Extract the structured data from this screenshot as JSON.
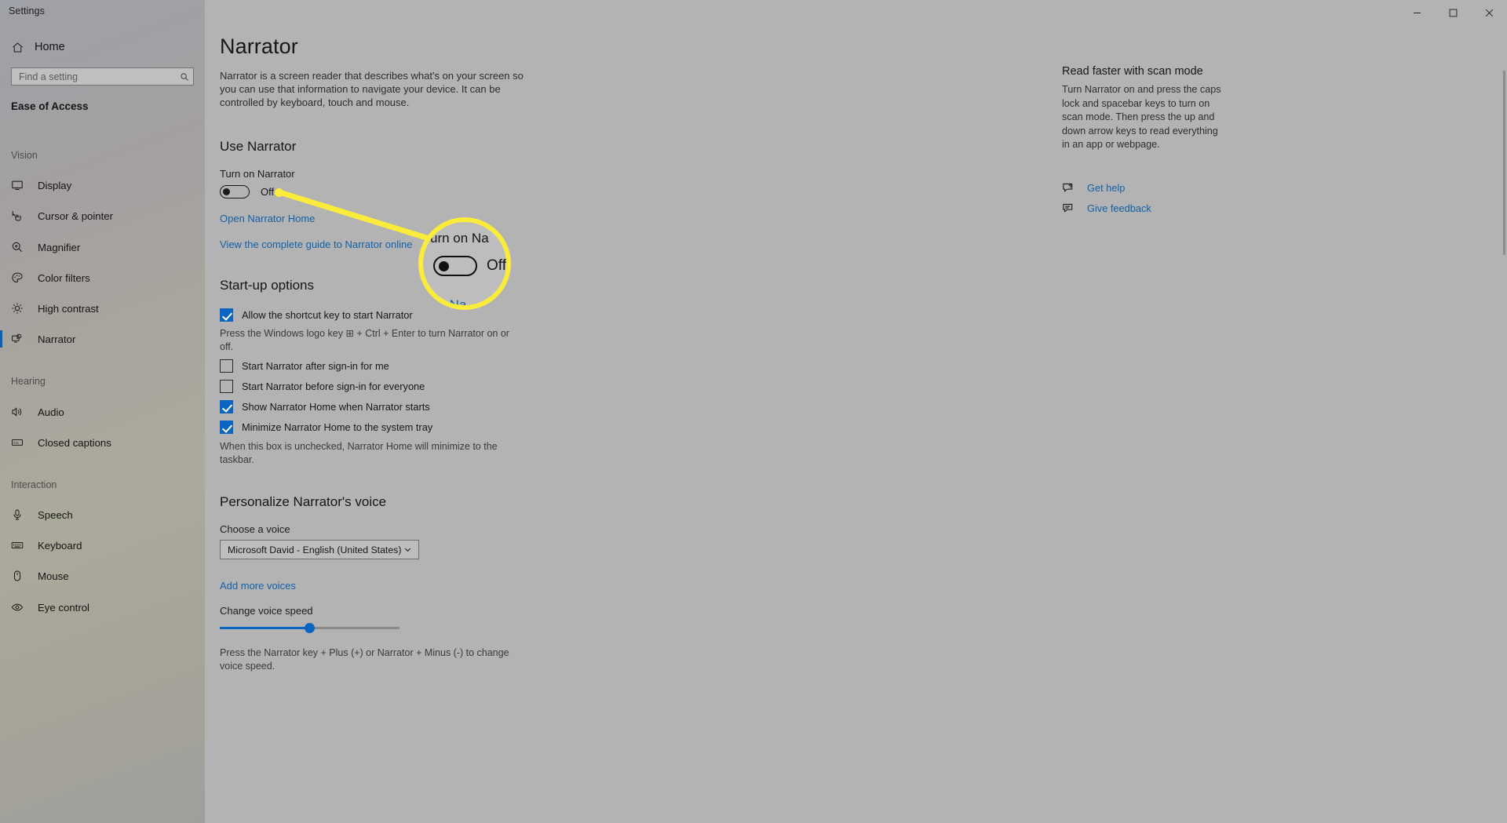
{
  "window": {
    "app_title": "Settings",
    "minimize_label": "Minimize",
    "maximize_label": "Maximize",
    "close_label": "Close"
  },
  "sidebar": {
    "home_label": "Home",
    "search": {
      "placeholder": "Find a setting",
      "value": ""
    },
    "section_title": "Ease of Access",
    "groups": [
      {
        "label": "Vision",
        "items": [
          {
            "label": "Display",
            "icon": "monitor-icon",
            "active": false
          },
          {
            "label": "Cursor & pointer",
            "icon": "cursor-pointer-icon",
            "active": false
          },
          {
            "label": "Magnifier",
            "icon": "magnifier-icon",
            "active": false
          },
          {
            "label": "Color filters",
            "icon": "palette-icon",
            "active": false
          },
          {
            "label": "High contrast",
            "icon": "brightness-icon",
            "active": false
          },
          {
            "label": "Narrator",
            "icon": "narrator-icon",
            "active": true
          }
        ]
      },
      {
        "label": "Hearing",
        "items": [
          {
            "label": "Audio",
            "icon": "speaker-icon",
            "active": false
          },
          {
            "label": "Closed captions",
            "icon": "closed-captions-icon",
            "active": false
          }
        ]
      },
      {
        "label": "Interaction",
        "items": [
          {
            "label": "Speech",
            "icon": "microphone-icon",
            "active": false
          },
          {
            "label": "Keyboard",
            "icon": "keyboard-icon",
            "active": false
          },
          {
            "label": "Mouse",
            "icon": "mouse-icon",
            "active": false
          },
          {
            "label": "Eye control",
            "icon": "eye-icon",
            "active": false
          }
        ]
      }
    ]
  },
  "main": {
    "title": "Narrator",
    "description": "Narrator is a screen reader that describes what's on your screen so you can use that information to navigate your device. It can be controlled by keyboard, touch and mouse.",
    "use_narrator": {
      "heading": "Use Narrator",
      "toggle_label": "Turn on Narrator",
      "toggle_state": "Off",
      "toggle_on": false,
      "open_home_link": "Open Narrator Home",
      "guide_link": "View the complete guide to Narrator online"
    },
    "startup": {
      "heading": "Start-up options",
      "checkboxes": [
        {
          "label": "Allow the shortcut key to start Narrator",
          "checked": true
        },
        {
          "label": "Start Narrator after sign-in for me",
          "checked": false
        },
        {
          "label": "Start Narrator before sign-in for everyone",
          "checked": false
        },
        {
          "label": "Show Narrator Home when Narrator starts",
          "checked": true
        },
        {
          "label": "Minimize Narrator Home to the system tray",
          "checked": true
        }
      ],
      "shortcut_note": "Press the Windows logo key ⊞ + Ctrl + Enter to turn Narrator on or off.",
      "minimize_note": "When this box is unchecked, Narrator Home will minimize to the taskbar."
    },
    "voice": {
      "heading": "Personalize Narrator's voice",
      "choose_voice_label": "Choose a voice",
      "selected_voice": "Microsoft David - English (United States)",
      "add_voices_link": "Add more voices",
      "speed_label": "Change voice speed",
      "speed_value": 50,
      "speed_note": "Press the Narrator key + Plus (+) or Narrator + Minus (-) to change voice speed."
    }
  },
  "right_panel": {
    "title": "Read faster with scan mode",
    "body": "Turn Narrator on and press the caps lock and spacebar keys to turn on scan mode. Then press the up and down arrow keys to read everything in an app or webpage.",
    "links": [
      {
        "label": "Get help",
        "icon": "help-chat-icon"
      },
      {
        "label": "Give feedback",
        "icon": "feedback-icon"
      }
    ]
  },
  "annotation": {
    "accent_color": "#fbec3c",
    "callout": {
      "title_text": "urn on Na",
      "toggle_state": "Off",
      "link_text": "en Na"
    }
  }
}
